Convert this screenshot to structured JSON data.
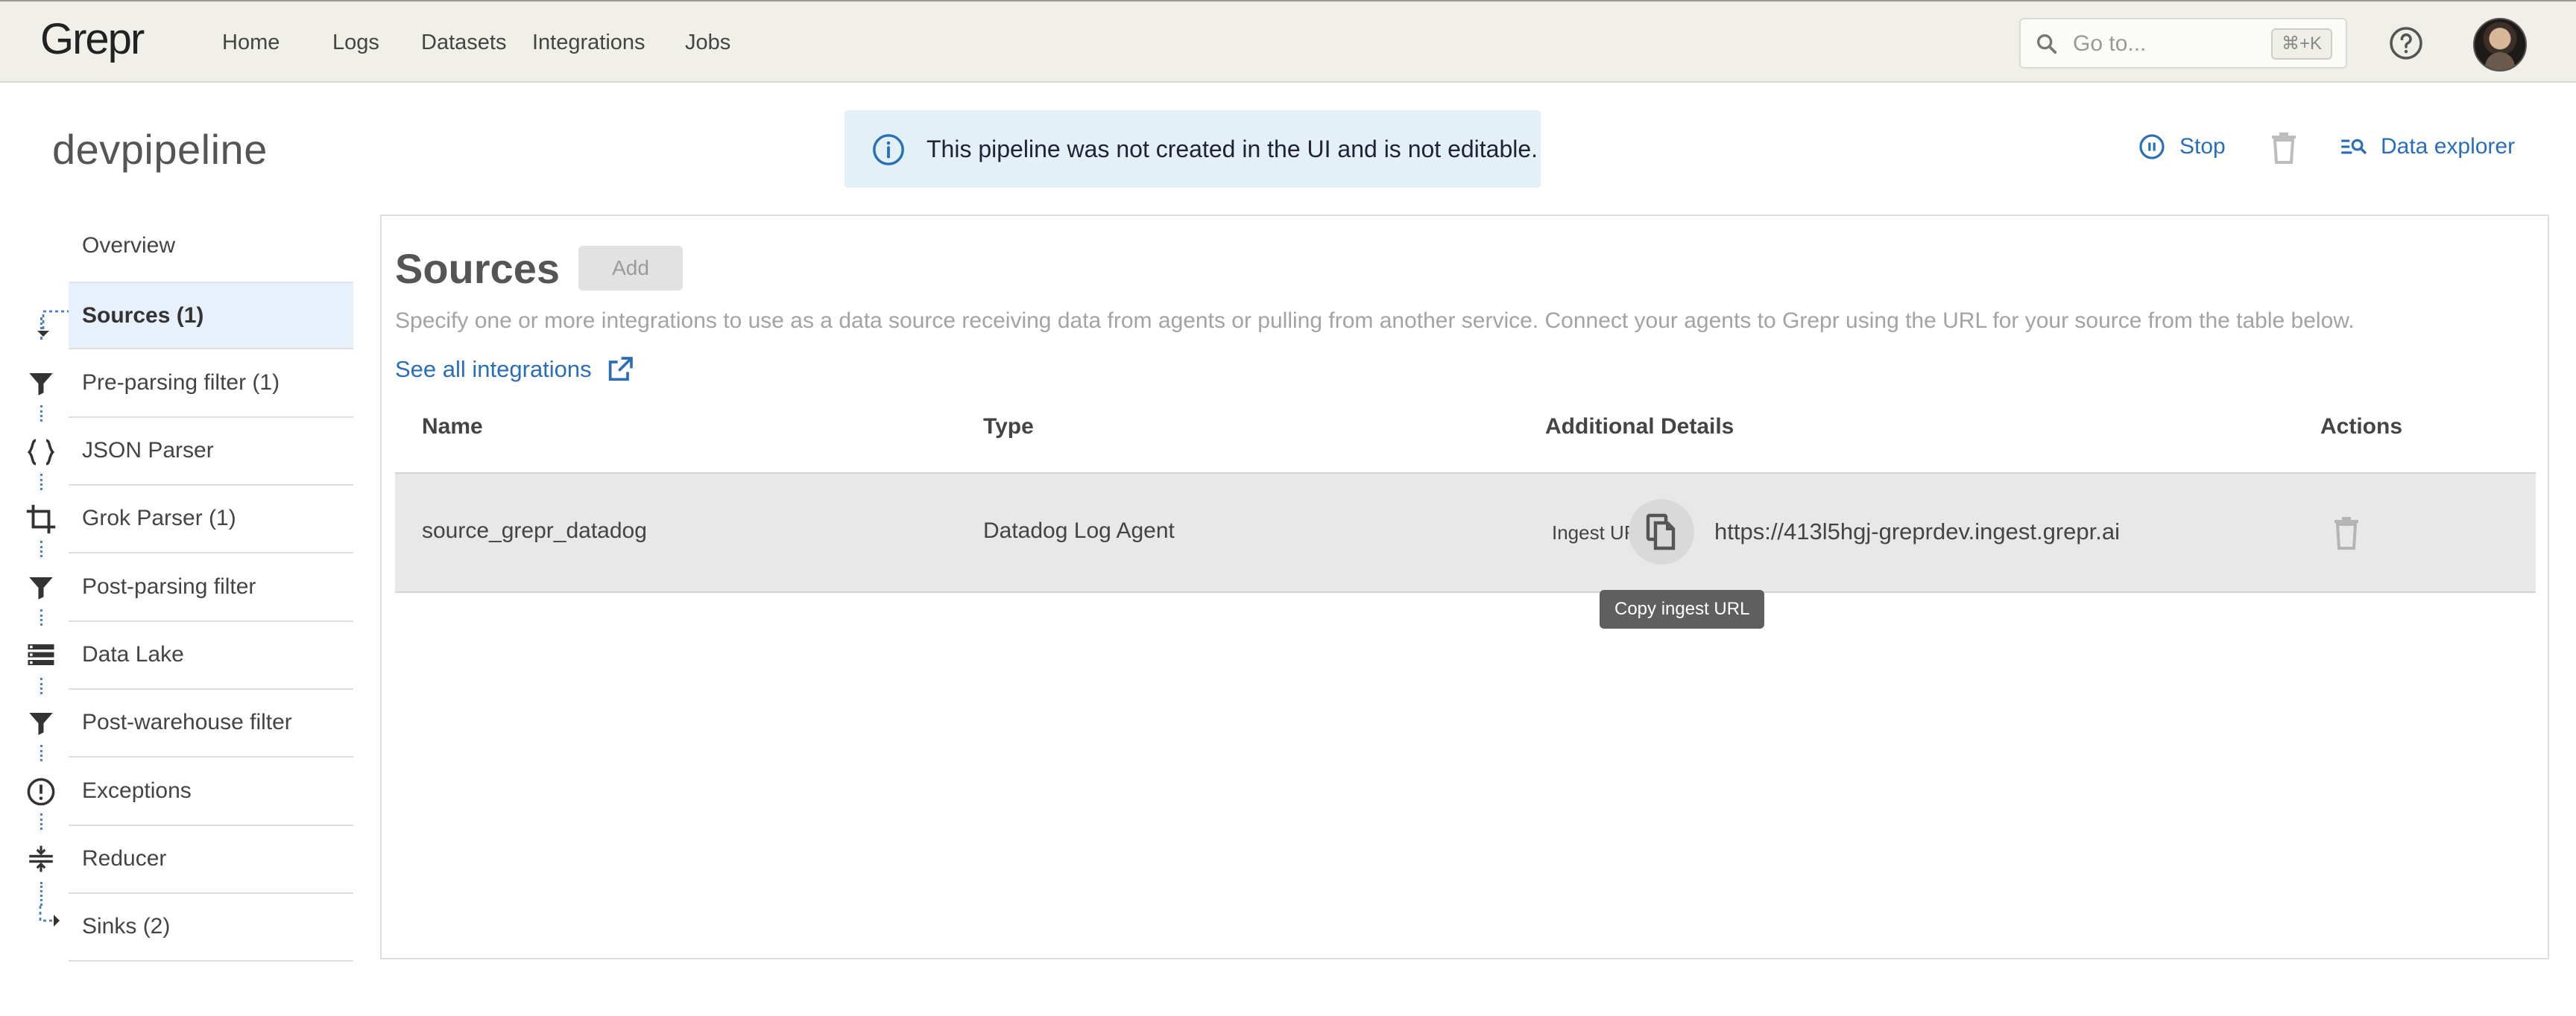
{
  "app": {
    "logo_text": "Grepr"
  },
  "nav": {
    "items": [
      {
        "label": "Home"
      },
      {
        "label": "Logs"
      },
      {
        "label": "Datasets"
      },
      {
        "label": "Integrations"
      },
      {
        "label": "Jobs"
      }
    ],
    "search": {
      "placeholder": "Go to...",
      "shortcut": "⌘+K"
    },
    "help_icon": "help-circle-icon",
    "avatar_icon": "user-avatar"
  },
  "page": {
    "title": "devpipeline",
    "notice": "This pipeline was not created in the UI and is not editable.",
    "actions": {
      "stop": "Stop",
      "data_explorer": "Data explorer"
    }
  },
  "steps": [
    {
      "label": "Overview",
      "icon": ""
    },
    {
      "label": "Sources (1)",
      "icon": "dotted-arrow-icon",
      "active": true
    },
    {
      "label": "Pre-parsing filter (1)",
      "icon": "filter-icon"
    },
    {
      "label": "JSON Parser",
      "icon": "braces-icon"
    },
    {
      "label": "Grok Parser (1)",
      "icon": "crop-icon"
    },
    {
      "label": "Post-parsing filter",
      "icon": "filter-icon"
    },
    {
      "label": "Data Lake",
      "icon": "storage-icon"
    },
    {
      "label": "Post-warehouse filter",
      "icon": "filter-icon"
    },
    {
      "label": "Exceptions",
      "icon": "alert-circle-icon"
    },
    {
      "label": "Reducer",
      "icon": "compress-icon"
    },
    {
      "label": "Sinks (2)",
      "icon": "dotted-arrow-end-icon"
    }
  ],
  "sources": {
    "title": "Sources",
    "add_label": "Add",
    "description": "Specify one or more integrations to use as a data source receiving data from agents or pulling from another service. Connect your agents to Grepr using the URL for your source from the table below.",
    "see_all": "See all integrations",
    "columns": [
      "Name",
      "Type",
      "Additional Details",
      "Actions"
    ],
    "rows": [
      {
        "name": "source_grepr_datadog",
        "type": "Datadog Log Agent",
        "ingest_label": "Ingest URL:",
        "ingest_url": "https://413l5hgj-greprdev.ingest.grepr.ai"
      }
    ],
    "tooltip": "Copy ingest URL"
  },
  "colors": {
    "accent": "#2a6eb8",
    "topbar_bg": "#f1f0e8",
    "notice_bg": "#e4f0f8",
    "active_step_bg": "#e8f1fb",
    "row_bg": "#e8e8e8"
  }
}
